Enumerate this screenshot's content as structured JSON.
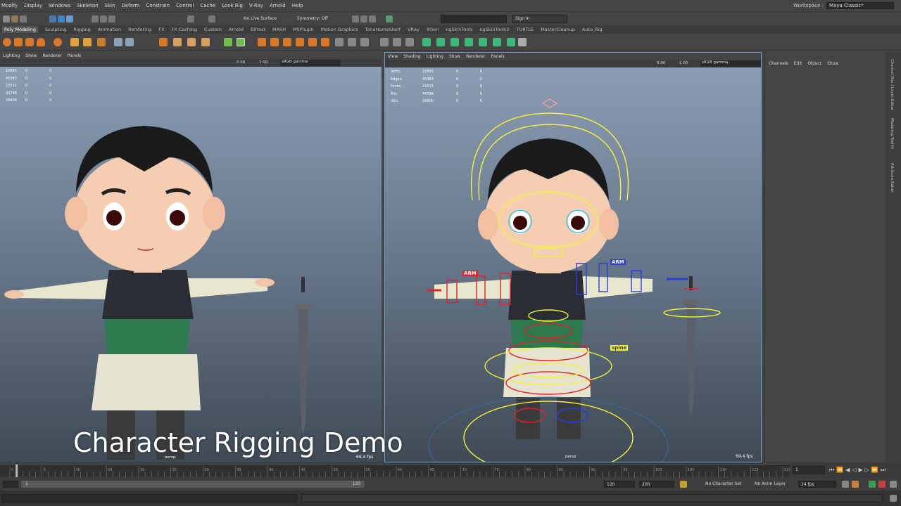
{
  "menubar": [
    "Modify",
    "Display",
    "Windows",
    "Skeleton",
    "Skin",
    "Deform",
    "Constrain",
    "Control",
    "Cache",
    "Look Rig",
    "V-Ray",
    "Arnold",
    "Help"
  ],
  "workspace": {
    "label": "Workspace :",
    "value": "Maya Classic*"
  },
  "statusline": {
    "live_surface": "No Live Surface",
    "symmetry": "Symmetry: Off",
    "sign_in": "Sign In"
  },
  "shelf_tabs": [
    "Poly Modeling",
    "Sculpting",
    "Rigging",
    "Animation",
    "Rendering",
    "FX",
    "FX Caching",
    "Custom",
    "Arnold",
    "Bifrost",
    "MASH",
    "MSPlugin",
    "Motion Graphics",
    "TanaHomeShelf",
    "VRay",
    "XGen",
    "ngSkinTools",
    "ngSkinTools2",
    "TURTLE",
    "MasterCleanup",
    "Auto_Rig"
  ],
  "viewport_menu_left": [
    "Lighting",
    "Show",
    "Renderer",
    "Panels"
  ],
  "viewport_menu_right": [
    "View",
    "Shading",
    "Lighting",
    "Show",
    "Renderer",
    "Panels"
  ],
  "viewport_toolbar": {
    "val1": "0.00",
    "val2": "1.00",
    "colorspace": "sRGB gamma"
  },
  "hud_left": [
    [
      "22895",
      "0",
      "0"
    ],
    [
      "45383",
      "0",
      "0"
    ],
    [
      "22515",
      "0",
      "0"
    ],
    [
      "44796",
      "0",
      "0"
    ],
    [
      "26806",
      "0",
      "0"
    ]
  ],
  "hud_right": [
    [
      "Verts:",
      "22895",
      "0",
      "0"
    ],
    [
      "Edges:",
      "45383",
      "0",
      "0"
    ],
    [
      "Faces:",
      "22515",
      "0",
      "0"
    ],
    [
      "Tris:",
      "44796",
      "0",
      "0"
    ],
    [
      "UVs:",
      "26806",
      "0",
      "0"
    ]
  ],
  "viewport_left": {
    "fps": "69.4 fps",
    "camera": "persp"
  },
  "viewport_right": {
    "fps": "69.4 fps",
    "camera": "persp"
  },
  "rig_labels": {
    "arm_left": "ARM",
    "arm_right": "ARM",
    "spine": "spine"
  },
  "channel_box": {
    "menu": [
      "Channels",
      "Edit",
      "Object",
      "Show"
    ]
  },
  "side_tabs": [
    "Channel Box / Layer Editor",
    "Modeling Toolkit",
    "Attribute Editor"
  ],
  "time_slider": {
    "ticks": [
      "0",
      "5",
      "10",
      "15",
      "20",
      "25",
      "30",
      "35",
      "40",
      "45",
      "50",
      "55",
      "60",
      "65",
      "70",
      "75",
      "80",
      "85",
      "90",
      "95",
      "100",
      "105",
      "110",
      "115",
      "120"
    ],
    "current_frame": "1"
  },
  "range_slider": {
    "start": "1",
    "end_inner": "120",
    "end": "120",
    "anim_end": "200",
    "character_set": "No Character Set",
    "anim_layer": "No Anim Layer",
    "fps": "24 fps"
  },
  "caption": "Character Rigging Demo",
  "colors": {
    "rig_yellow": "#f2f23a",
    "rig_red": "#e0222a",
    "rig_blue": "#2a3cdc",
    "selection": "#6ea0d0"
  }
}
